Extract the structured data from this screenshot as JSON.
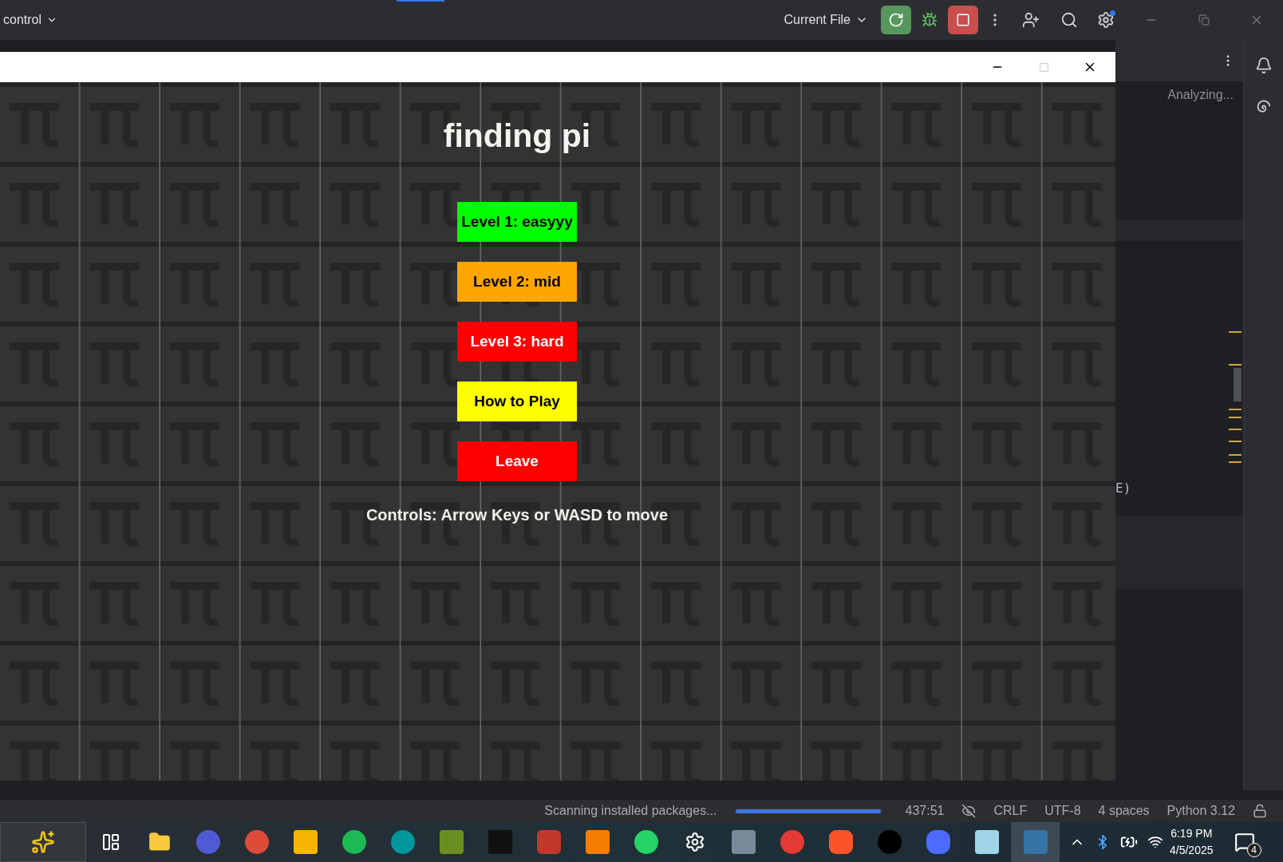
{
  "ide_toolbar": {
    "project": "control",
    "run_config": "Current File"
  },
  "game_window": {
    "title": "finding pi",
    "menu_buttons": [
      {
        "label": "Level 1: easyyy",
        "color": "#00ff00"
      },
      {
        "label": "Level 2: mid",
        "color": "#ffa500"
      },
      {
        "label": "Level 3: hard",
        "color": "#ff0000"
      },
      {
        "label": "How to Play",
        "color": "#ffff00"
      },
      {
        "label": "Leave",
        "color": "#ff0000"
      }
    ],
    "controls_hint": "Controls: Arrow Keys or WASD to move"
  },
  "editor": {
    "status": "Analyzing...",
    "code_fragment": "E)"
  },
  "status_bar": {
    "task": "Scanning installed packages...",
    "progress": {
      "level": 1
    },
    "position": "437:51",
    "line_ending": "CRLF",
    "encoding": "UTF-8",
    "indent": "4 spaces",
    "interpreter": "Python 3.12"
  },
  "taskbar": {
    "time": "6:19 PM",
    "date": "4/5/2025",
    "notifications": "4"
  }
}
